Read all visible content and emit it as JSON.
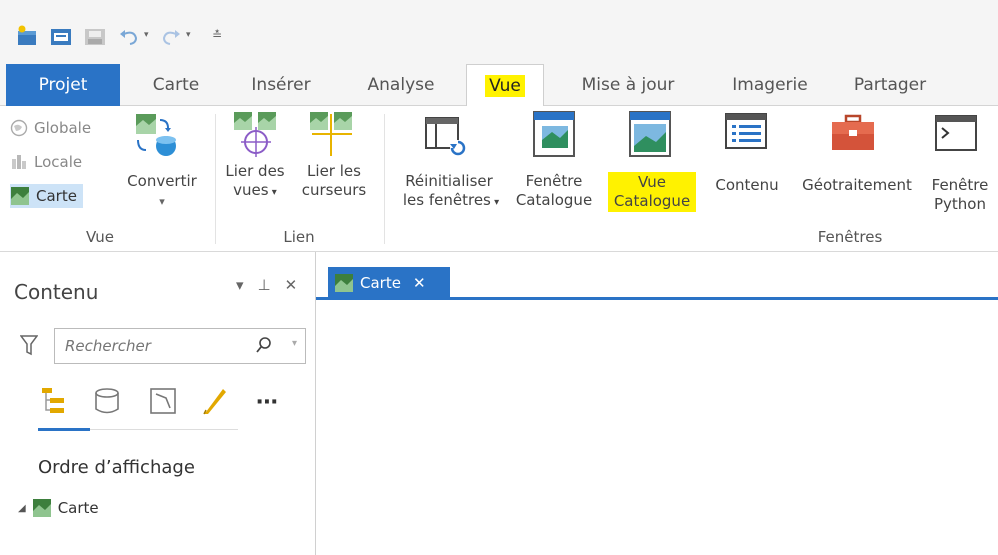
{
  "quick_access": {
    "icons": [
      "new-project-icon",
      "open-project-icon",
      "save-project-icon",
      "undo-icon",
      "redo-icon",
      "customize-icon"
    ]
  },
  "tabs": [
    {
      "label": "Projet"
    },
    {
      "label": "Carte"
    },
    {
      "label": "Insérer"
    },
    {
      "label": "Analyse"
    },
    {
      "label": "Vue"
    },
    {
      "label": "Mise à jour"
    },
    {
      "label": "Imagerie"
    },
    {
      "label": "Partager"
    }
  ],
  "ribbon": {
    "vue_group": {
      "label": "Vue",
      "globale": "Globale",
      "locale": "Locale",
      "carte": "Carte",
      "convertir": "Convertir"
    },
    "lien_group": {
      "label": "Lien",
      "lier_vues_1": "Lier des",
      "lier_vues_2": "vues",
      "lier_curseurs_1": "Lier les",
      "lier_curseurs_2": "curseurs"
    },
    "fenetres_group": {
      "label": "Fenêtres",
      "reinit_1": "Réinitialiser",
      "reinit_2": "les fenêtres",
      "fenetre_cat_1": "Fenêtre",
      "fenetre_cat_2": "Catalogue",
      "vue_cat_1": "Vue",
      "vue_cat_2": "Catalogue",
      "contenu": "Contenu",
      "geotraitement": "Géotraitement",
      "python_1": "Fenêtre",
      "python_2": "Python"
    }
  },
  "contents_pane": {
    "title": "Contenu",
    "search_placeholder": "Rechercher",
    "section_title": "Ordre d’affichage",
    "layers": [
      {
        "label": "Carte"
      }
    ]
  },
  "map_view": {
    "tab_label": "Carte",
    "close": "✕"
  },
  "colors": {
    "accent": "#2a73c6",
    "highlight": "#fff200"
  }
}
